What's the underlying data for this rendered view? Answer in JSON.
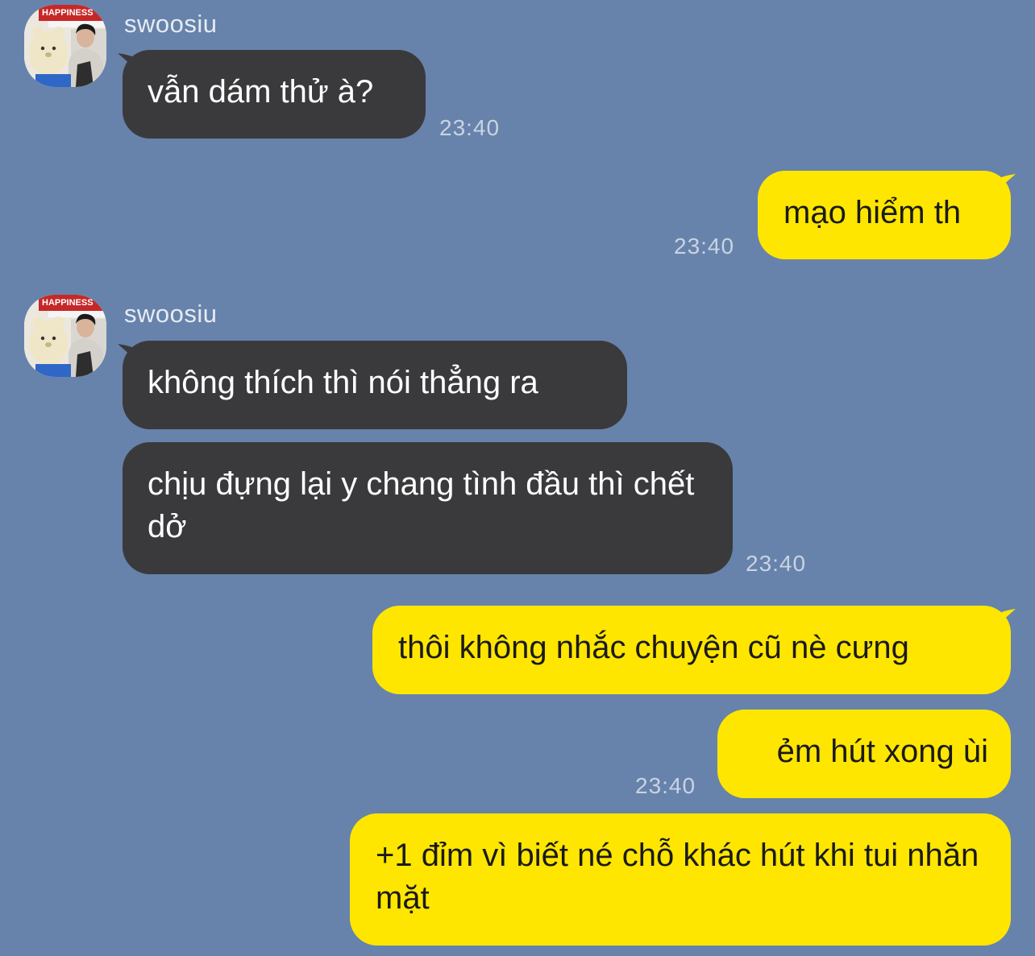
{
  "colors": {
    "background": "#6783ab",
    "incoming_bubble": "#3a3a3c",
    "outgoing_bubble": "#ffe600",
    "timestamp": "#c9d3e3"
  },
  "messages": [
    {
      "sender": "swoosiu",
      "direction": "incoming",
      "text": "vẫn dám thử à?",
      "time": "23:40"
    },
    {
      "direction": "outgoing",
      "text": "mạo hiểm th",
      "time": "23:40"
    },
    {
      "sender": "swoosiu",
      "direction": "incoming",
      "text": "không thích thì nói thẳng ra"
    },
    {
      "direction": "incoming",
      "text": "chịu đựng lại y chang tình đầu thì chết dở",
      "time": "23:40"
    },
    {
      "direction": "outgoing",
      "text": "thôi không nhắc chuyện cũ nè cưng"
    },
    {
      "direction": "outgoing",
      "text": "ẻm hút xong ùi",
      "time": "23:40"
    },
    {
      "direction": "outgoing",
      "text": "+1 đỉm vì biết né chỗ khác hút khi tui nhăn mặt"
    }
  ],
  "avatar": {
    "icon": "user-avatar-photo"
  },
  "avatar_sign_text": "HAPPINESS"
}
